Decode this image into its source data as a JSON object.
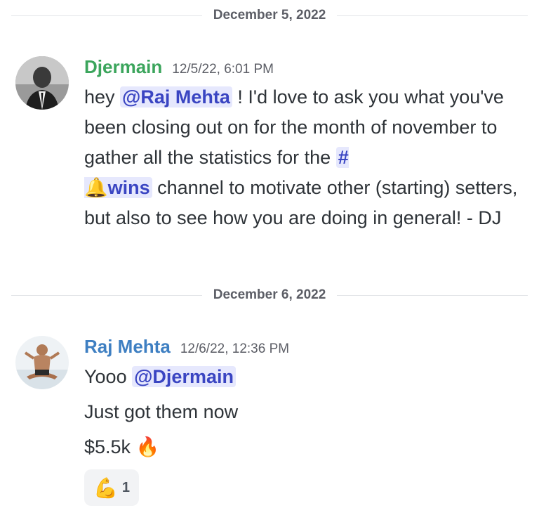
{
  "dividers": [
    {
      "date": "December 5, 2022"
    },
    {
      "date": "December 6, 2022"
    }
  ],
  "messages": [
    {
      "author": "Djermain",
      "author_color": "#3ba55c",
      "timestamp": "12/5/22, 6:01 PM",
      "parts": {
        "p1": "hey ",
        "mention": "@Raj Mehta",
        "p2": " ! I'd love to ask you what you've been closing out on for the month of november to gather all the statistics for the ",
        "channel_hash": "#",
        "channel_emoji": "🔔",
        "channel_name": "wins",
        "p3": " channel to motivate other (starting) setters, but also to see how you are doing in general! - DJ"
      }
    },
    {
      "author": "Raj Mehta",
      "author_color": "#3e7fc2",
      "timestamp": "12/6/22, 12:36 PM",
      "lines": {
        "l1_text": "Yooo ",
        "l1_mention": "@Djermain",
        "l2": "Just got them now",
        "l3_text": "$5.5k ",
        "l3_emoji": "🔥"
      },
      "reaction": {
        "emoji": "💪",
        "count": "1",
        "icon": "flexed-biceps-icon"
      }
    }
  ]
}
